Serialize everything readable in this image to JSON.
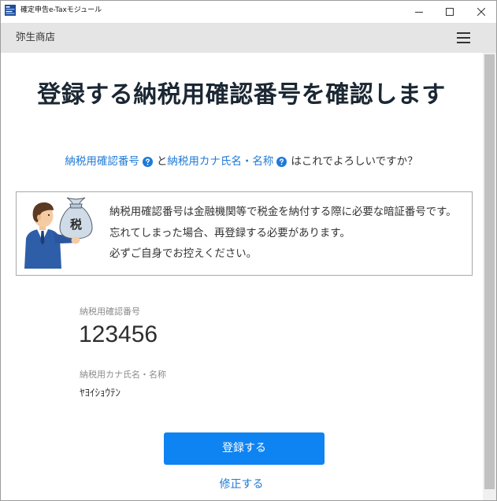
{
  "window": {
    "title": "確定申告e-Taxモジュール",
    "app_icon": "etax-app-icon",
    "controls": {
      "minimize": "minimize-icon",
      "maximize": "maximize-icon",
      "close": "close-icon"
    }
  },
  "header": {
    "company_name": "弥生商店",
    "menu_icon": "hamburger-menu-icon"
  },
  "main": {
    "heading": "登録する納税用確認番号を確認します",
    "question": {
      "link_number": "納税用確認番号",
      "conjunction": "と",
      "link_kana_name": "納税用カナ氏名・名称",
      "suffix": "はこれでよろしいですか？",
      "help_icon": "help-icon"
    },
    "notice": {
      "bag_label": "税",
      "lines": [
        "納税用確認番号は金融機関等で税金を納付する際に必要な暗証番号です。",
        "忘れてしまった場合、再登録する必要があります。",
        "必ずご自身でお控えください。"
      ]
    },
    "fields": [
      {
        "label": "納税用確認番号",
        "value": "123456"
      },
      {
        "label": "納税用カナ氏名・名称",
        "value": "ﾔﾖｲｼｮｳﾃﾝ"
      }
    ],
    "register_button_label": "登録する",
    "edit_link_label": "修正する"
  },
  "colors": {
    "accent": "#0e83f2",
    "link": "#1f7ad6",
    "heading": "#1b2733",
    "header_bg": "#e5e5e5"
  }
}
